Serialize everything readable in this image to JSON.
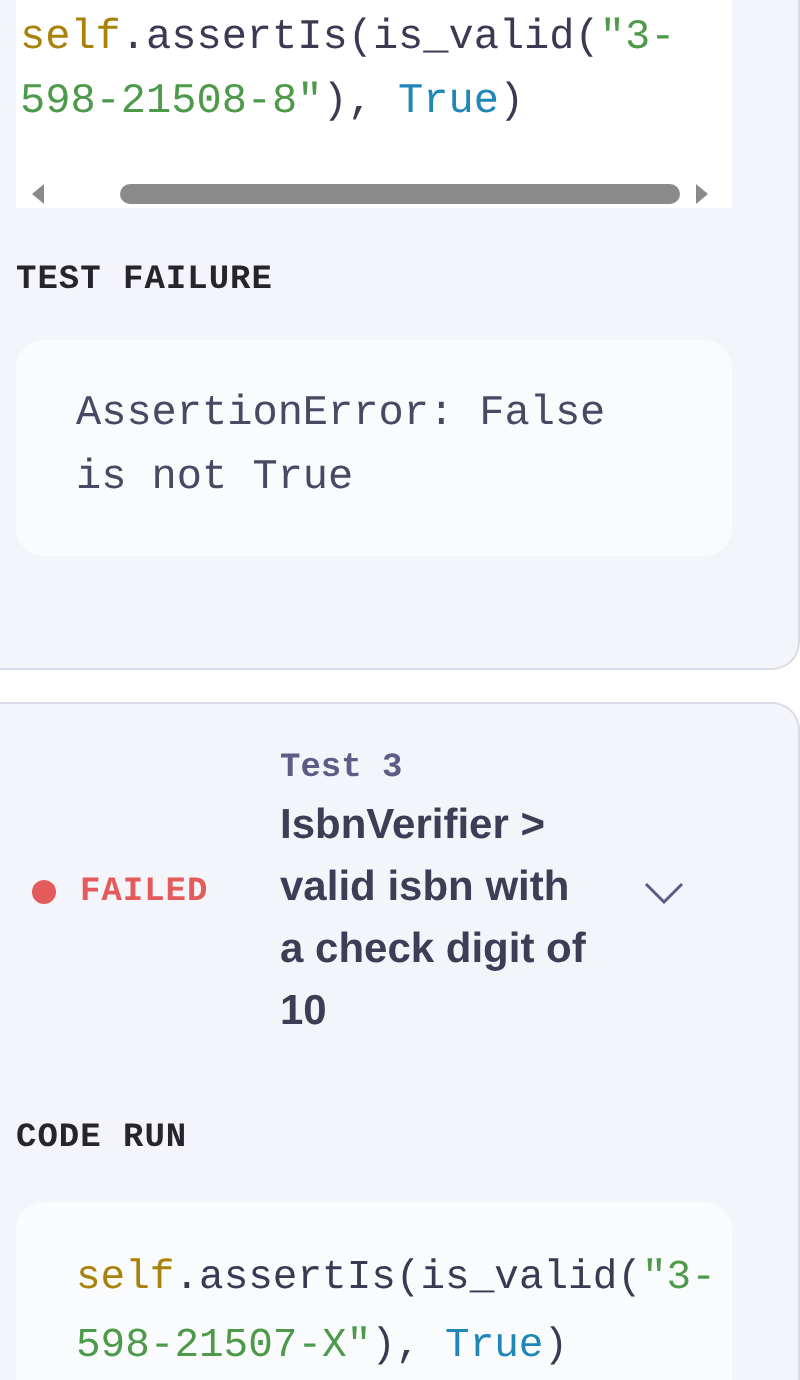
{
  "previous_test": {
    "code": [
      {
        "kind": "self",
        "text": "self"
      },
      {
        "kind": "plain",
        "text": ".assertIs(is_valid("
      },
      {
        "kind": "string",
        "text": "\"3-598-21508-8\""
      },
      {
        "kind": "plain",
        "text": "), "
      },
      {
        "kind": "keyword",
        "text": "True"
      },
      {
        "kind": "plain",
        "text": ")"
      }
    ],
    "failure": {
      "heading": "TEST FAILURE",
      "message": "AssertionError: False is not True"
    }
  },
  "test": {
    "status": {
      "kind": "failed",
      "text": "FAILED"
    },
    "label": "Test 3",
    "title": "IsbnVerifier > valid isbn with a check digit of 10",
    "code_heading": "CODE RUN",
    "code": [
      {
        "kind": "self",
        "text": "self"
      },
      {
        "kind": "plain",
        "text": ".assertIs(is_valid("
      },
      {
        "kind": "string",
        "text": "\"3-598-21507-X\""
      },
      {
        "kind": "plain",
        "text": "), "
      },
      {
        "kind": "keyword",
        "text": "True"
      },
      {
        "kind": "plain",
        "text": ")"
      }
    ]
  }
}
